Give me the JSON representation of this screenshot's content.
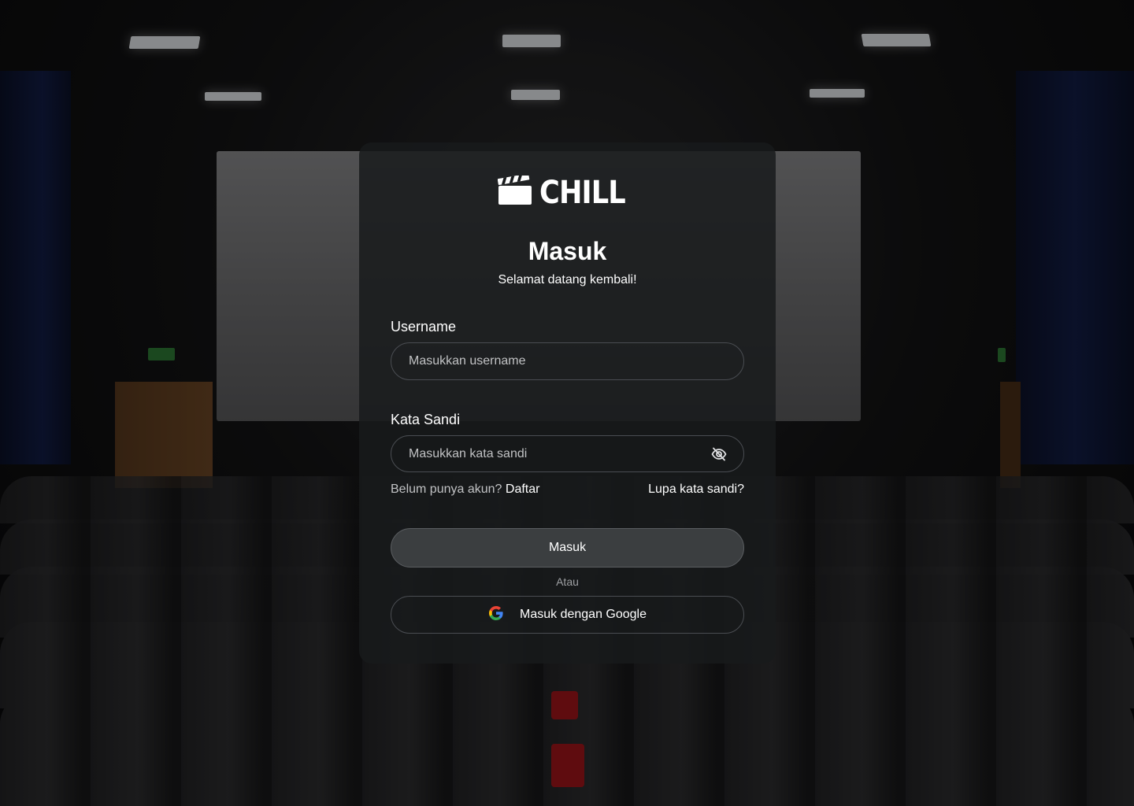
{
  "brand": {
    "name": "CHILL",
    "icon": "clapperboard-icon"
  },
  "form": {
    "title": "Masuk",
    "subtitle": "Selamat datang kembali!",
    "username": {
      "label": "Username",
      "placeholder": "Masukkan username",
      "value": ""
    },
    "password": {
      "label": "Kata Sandi",
      "placeholder": "Masukkan kata sandi",
      "value": "",
      "toggle_icon": "eye-off-icon"
    },
    "no_account_text": "Belum punya akun?",
    "register_link": "Daftar",
    "forgot_link": "Lupa kata sandi?",
    "submit_label": "Masuk",
    "divider": "Atau",
    "google_label": "Masuk dengan Google",
    "google_icon": "google-icon"
  },
  "colors": {
    "card_background": "#181a1c",
    "primary_button": "#3b3e40",
    "border": "#4a4d52",
    "text": "#ffffff",
    "muted_text": "#c1c2c4"
  }
}
